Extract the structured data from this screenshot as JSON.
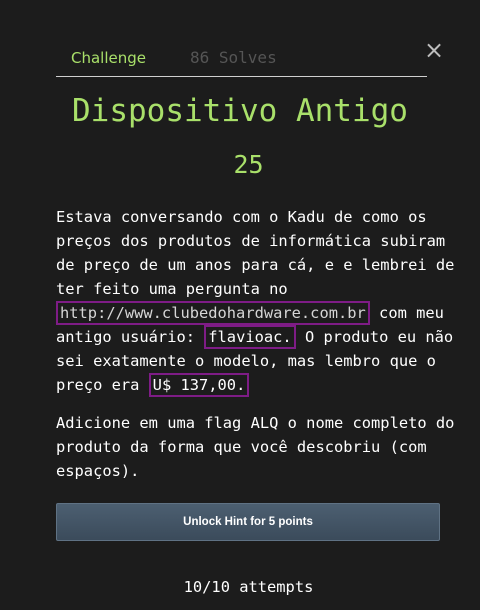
{
  "tabs": {
    "challenge": "Challenge",
    "solves": "86 Solves"
  },
  "close_icon": "×",
  "challenge": {
    "title": "Dispositivo Antigo",
    "points": "25",
    "description": {
      "p1_a": "Estava conversando com o Kadu de como os preços dos produtos de informática subiram de preço de um anos para cá, e e lembrei de ter feito uma pergunta no ",
      "url": "http://www.clubedohardware.com.br",
      "p1_b": " com meu antigo usuário: ",
      "username": "flavioac.",
      "p1_c": " O produto eu não sei exatamente o modelo, mas lembro que o preço era ",
      "price": "U$ 137,00.",
      "p2": "Adicione em uma flag ALQ o nome completo do produto da forma que você descobriu (com espaços)."
    }
  },
  "hint_button": "Unlock Hint for 5 points",
  "attempts": "10/10 attempts",
  "colors": {
    "accent_green": "#a9e06a",
    "highlight_box": "#7e1c86",
    "button_bg": "#435566"
  }
}
